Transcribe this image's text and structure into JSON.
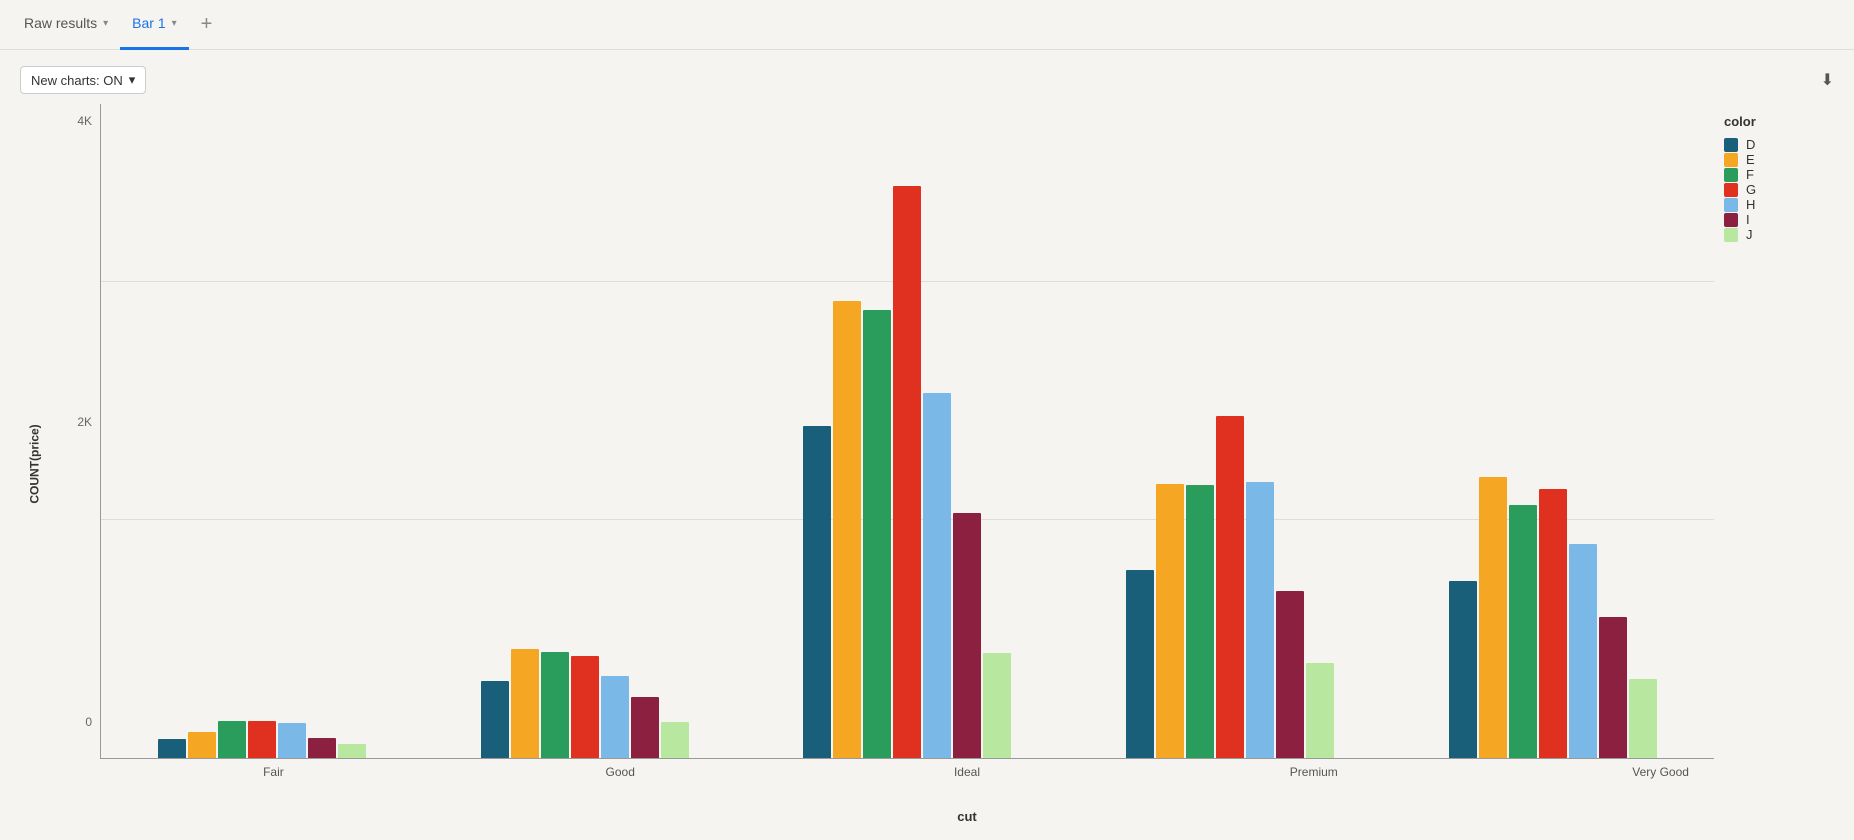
{
  "tabs": [
    {
      "id": "raw-results",
      "label": "Raw results",
      "active": false,
      "hasChevron": true
    },
    {
      "id": "bar-1",
      "label": "Bar 1",
      "active": true,
      "hasChevron": true
    }
  ],
  "add_tab_label": "+",
  "toolbar": {
    "new_charts_label": "New charts: ON",
    "chevron": "▾",
    "download_title": "Download"
  },
  "legend": {
    "title": "color",
    "items": [
      {
        "id": "D",
        "label": "D",
        "color": "#1a5f7a"
      },
      {
        "id": "E",
        "label": "E",
        "color": "#f5a623"
      },
      {
        "id": "F",
        "label": "F",
        "color": "#2a9d5c"
      },
      {
        "id": "G",
        "label": "G",
        "color": "#e03020"
      },
      {
        "id": "H",
        "label": "H",
        "color": "#7ab8e8"
      },
      {
        "id": "I",
        "label": "I",
        "color": "#8b2040"
      },
      {
        "id": "J",
        "label": "J",
        "color": "#b8e8a0"
      }
    ]
  },
  "chart": {
    "y_axis_label": "COUNT(price)",
    "x_axis_label": "cut",
    "y_ticks": [
      "4K",
      "2K",
      "0"
    ],
    "y_max": 5500,
    "groups": [
      {
        "label": "Fair",
        "bars": [
          {
            "color_id": "D",
            "value": 163,
            "color": "#1a5f7a"
          },
          {
            "color_id": "E",
            "value": 224,
            "color": "#f5a623"
          },
          {
            "color_id": "F",
            "value": 312,
            "color": "#2a9d5c"
          },
          {
            "color_id": "G",
            "value": 314,
            "color": "#e03020"
          },
          {
            "color_id": "H",
            "value": 303,
            "color": "#7ab8e8"
          },
          {
            "color_id": "I",
            "value": 175,
            "color": "#8b2040"
          },
          {
            "color_id": "J",
            "value": 119,
            "color": "#b8e8a0"
          }
        ]
      },
      {
        "label": "Good",
        "bars": [
          {
            "color_id": "D",
            "value": 662,
            "color": "#1a5f7a"
          },
          {
            "color_id": "E",
            "value": 933,
            "color": "#f5a623"
          },
          {
            "color_id": "F",
            "value": 909,
            "color": "#2a9d5c"
          },
          {
            "color_id": "G",
            "value": 871,
            "color": "#e03020"
          },
          {
            "color_id": "H",
            "value": 702,
            "color": "#7ab8e8"
          },
          {
            "color_id": "I",
            "value": 522,
            "color": "#8b2040"
          },
          {
            "color_id": "J",
            "value": 307,
            "color": "#b8e8a0"
          }
        ]
      },
      {
        "label": "Ideal",
        "bars": [
          {
            "color_id": "D",
            "value": 2834,
            "color": "#1a5f7a"
          },
          {
            "color_id": "E",
            "value": 3903,
            "color": "#f5a623"
          },
          {
            "color_id": "F",
            "value": 3826,
            "color": "#2a9d5c"
          },
          {
            "color_id": "G",
            "value": 4884,
            "color": "#e03020"
          },
          {
            "color_id": "H",
            "value": 3115,
            "color": "#7ab8e8"
          },
          {
            "color_id": "I",
            "value": 2093,
            "color": "#8b2040"
          },
          {
            "color_id": "J",
            "value": 896,
            "color": "#b8e8a0"
          }
        ]
      },
      {
        "label": "Premium",
        "bars": [
          {
            "color_id": "D",
            "value": 1603,
            "color": "#1a5f7a"
          },
          {
            "color_id": "E",
            "value": 2337,
            "color": "#f5a623"
          },
          {
            "color_id": "F",
            "value": 2331,
            "color": "#2a9d5c"
          },
          {
            "color_id": "G",
            "value": 2924,
            "color": "#e03020"
          },
          {
            "color_id": "H",
            "value": 2360,
            "color": "#7ab8e8"
          },
          {
            "color_id": "I",
            "value": 1428,
            "color": "#8b2040"
          },
          {
            "color_id": "J",
            "value": 808,
            "color": "#b8e8a0"
          }
        ]
      },
      {
        "label": "Very Good",
        "bars": [
          {
            "color_id": "D",
            "value": 1513,
            "color": "#1a5f7a"
          },
          {
            "color_id": "E",
            "value": 2400,
            "color": "#f5a623"
          },
          {
            "color_id": "F",
            "value": 2164,
            "color": "#2a9d5c"
          },
          {
            "color_id": "G",
            "value": 2299,
            "color": "#e03020"
          },
          {
            "color_id": "H",
            "value": 1824,
            "color": "#7ab8e8"
          },
          {
            "color_id": "I",
            "value": 1204,
            "color": "#8b2040"
          },
          {
            "color_id": "J",
            "value": 678,
            "color": "#b8e8a0"
          }
        ]
      }
    ]
  }
}
